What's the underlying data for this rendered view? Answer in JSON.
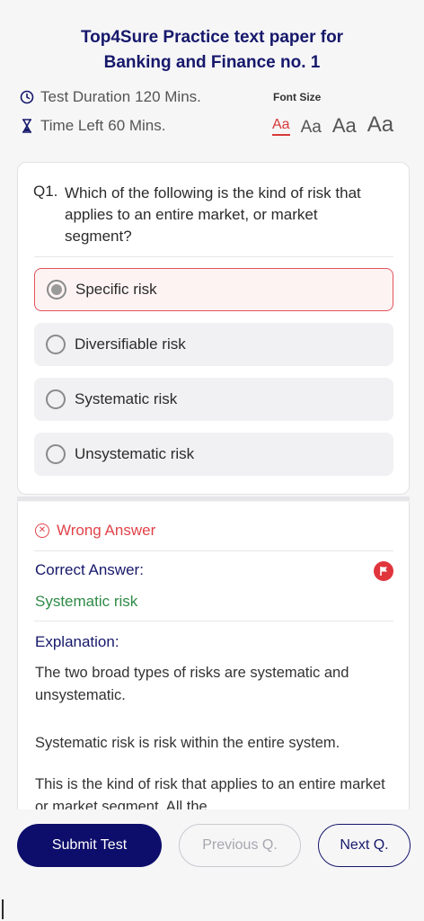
{
  "header": {
    "title_line1": "Top4Sure Practice text paper for",
    "title_line2": "Banking and Finance no. 1"
  },
  "test_info": {
    "duration_label": "Test Duration",
    "duration_value": "120 Mins.",
    "time_left_label": "Time Left",
    "time_left_value": "60 Mins."
  },
  "font_size": {
    "label": "Font Size",
    "options": [
      "Aa",
      "Aa",
      "Aa",
      "Aa"
    ],
    "selected_index": 0
  },
  "question": {
    "number": "Q1.",
    "text": "Which of the following is the kind of risk that applies to an entire market, or market segment?",
    "options": [
      "Specific risk",
      "Diversifiable risk",
      "Systematic risk",
      "Unsystematic risk"
    ],
    "selected_index": 0
  },
  "result": {
    "status": "Wrong Answer",
    "correct_answer_label": "Correct Answer:",
    "correct_answer": "Systematic risk",
    "explanation_label": "Explanation:",
    "explanation": [
      "The two broad types of risks are systematic and unsystematic.",
      "Systematic risk is risk within the entire system.",
      "This is the kind of risk that applies to an entire market or market segment. All the"
    ]
  },
  "footer": {
    "submit_label": "Submit Test",
    "previous_label": "Previous Q.",
    "next_label": "Next Q."
  },
  "colors": {
    "brand": "#16186b",
    "primary_button": "#0d0d6b",
    "error": "#e0434a",
    "correct": "#2e8a46"
  }
}
